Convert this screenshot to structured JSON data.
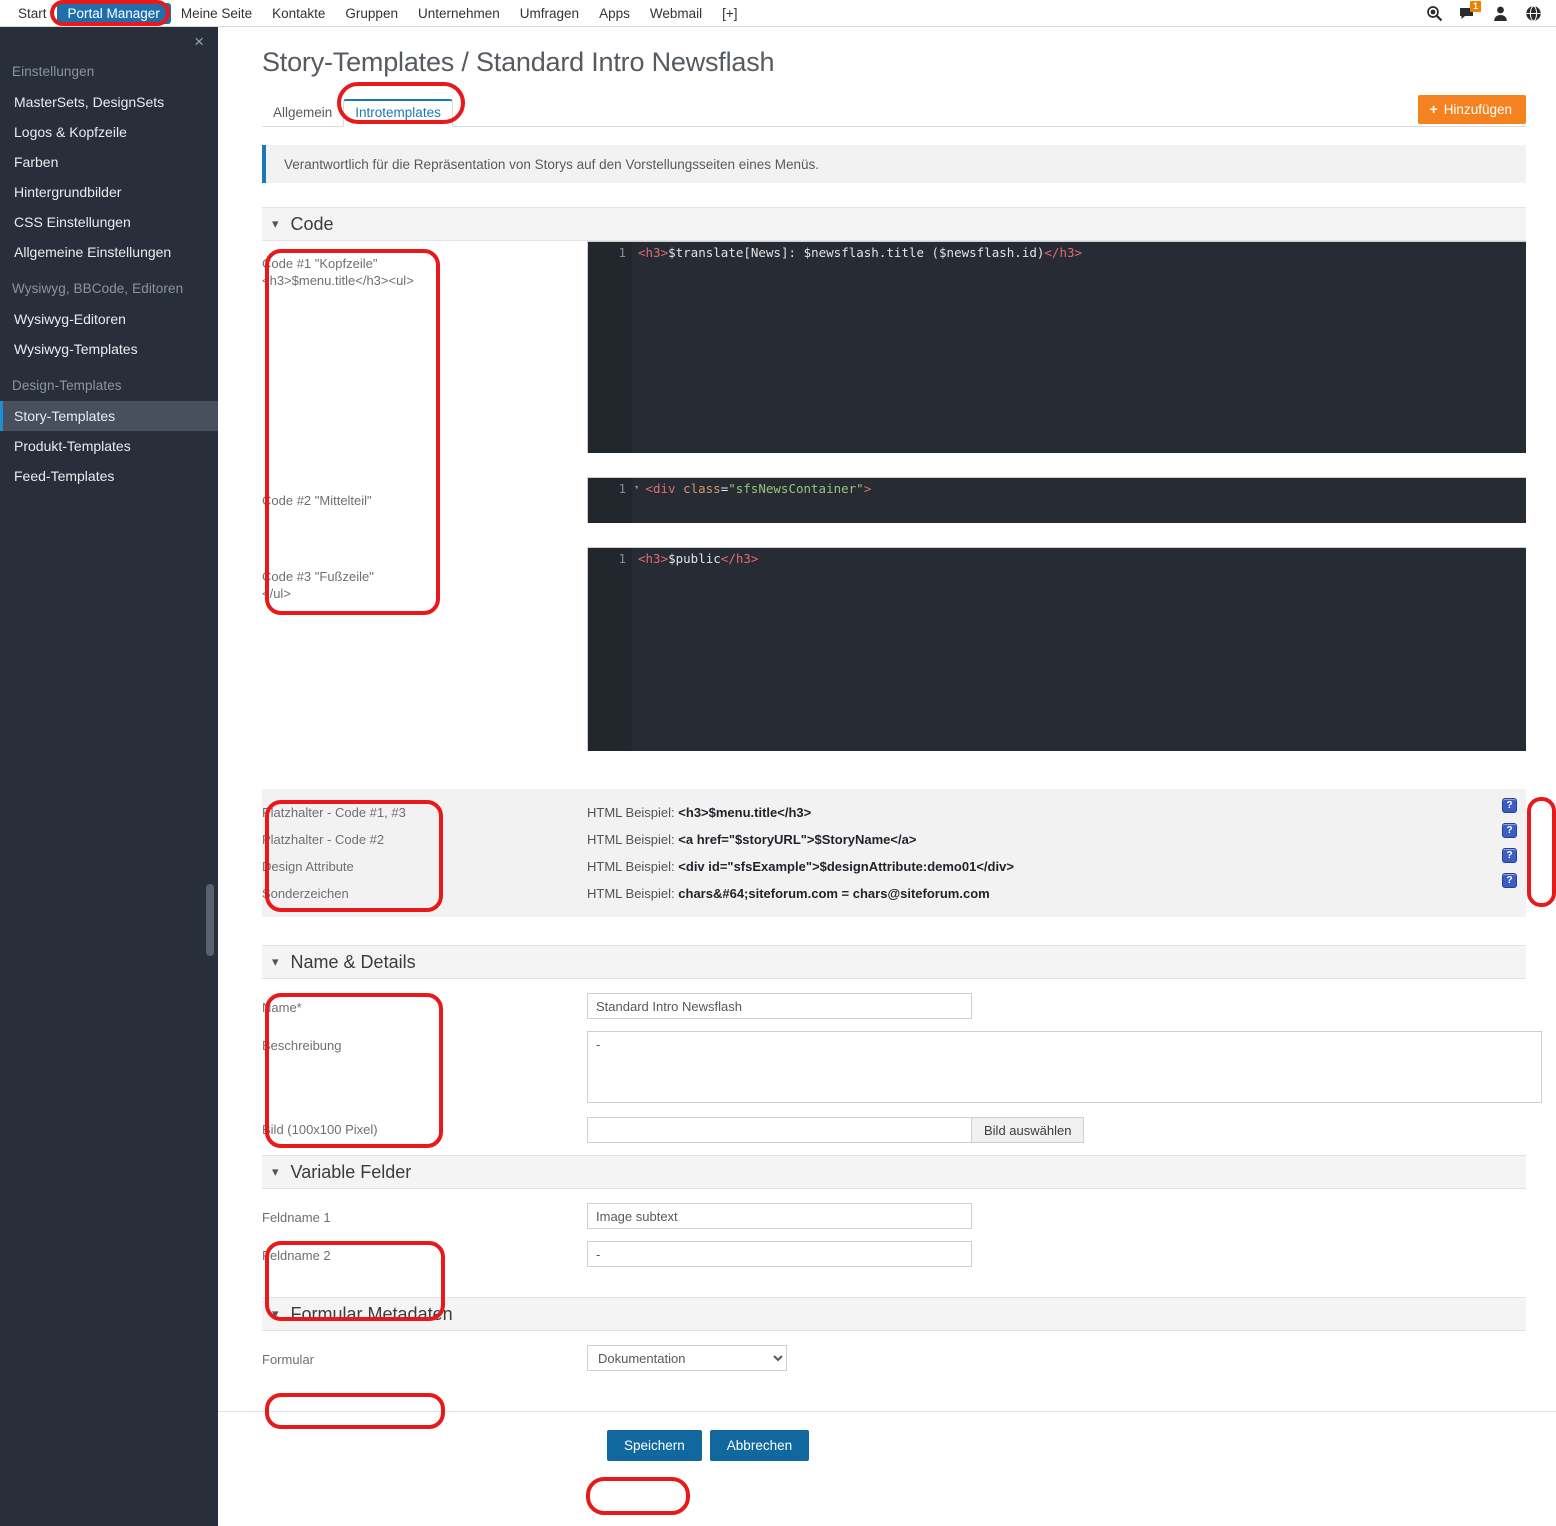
{
  "topnav": {
    "items": [
      {
        "label": "Start",
        "active": false
      },
      {
        "label": "Portal Manager",
        "active": true
      },
      {
        "label": "Meine Seite",
        "active": false
      },
      {
        "label": "Kontakte",
        "active": false
      },
      {
        "label": "Gruppen",
        "active": false
      },
      {
        "label": "Unternehmen",
        "active": false
      },
      {
        "label": "Umfragen",
        "active": false
      },
      {
        "label": "Apps",
        "active": false
      },
      {
        "label": "Webmail",
        "active": false
      },
      {
        "label": "[+]",
        "active": false
      }
    ],
    "icons": [
      "search-icon",
      "messages-icon",
      "user-icon",
      "globe-icon"
    ],
    "message_badge": "1",
    "badge_color": "#f08000",
    "active_color": "#1f6fad"
  },
  "sidebar": {
    "close_label": "×",
    "groups": [
      {
        "title": "Einstellungen",
        "items": [
          {
            "label": "MasterSets, DesignSets",
            "selected": false
          },
          {
            "label": "Logos & Kopfzeile",
            "selected": false
          },
          {
            "label": "Farben",
            "selected": false
          },
          {
            "label": "Hintergrundbilder",
            "selected": false
          },
          {
            "label": "CSS Einstellungen",
            "selected": false
          },
          {
            "label": "Allgemeine Einstellungen",
            "selected": false
          }
        ]
      },
      {
        "title": "Wysiwyg, BBCode, Editoren",
        "items": [
          {
            "label": "Wysiwyg-Editoren",
            "selected": false
          },
          {
            "label": "Wysiwyg-Templates",
            "selected": false
          }
        ]
      },
      {
        "title": "Design-Templates",
        "items": [
          {
            "label": "Story-Templates",
            "selected": true
          },
          {
            "label": "Produkt-Templates",
            "selected": false
          },
          {
            "label": "Feed-Templates",
            "selected": false
          }
        ]
      }
    ],
    "accent_color": "#1b8fd4",
    "background": "#282f3a"
  },
  "page": {
    "title": "Story-Templates / Standard Intro Newsflash",
    "tabs": [
      {
        "label": "Allgemein",
        "active": false
      },
      {
        "label": "Introtemplates",
        "active": true
      }
    ],
    "add_button": {
      "label": "Hinzufügen",
      "icon": "plus-icon",
      "color": "#f58220"
    },
    "info_text": "Verantwortlich für die Repräsentation von Storys auf den Vorstellungsseiten eines Menüs."
  },
  "sections": {
    "code": {
      "title": "Code",
      "labels": [
        {
          "line1": "Code #1 \"Kopfzeile\"",
          "line2": "<h3>$menu.title</h3><ul>"
        },
        {
          "line1": "Code #2 \"Mittelteil\"",
          "line2": ""
        },
        {
          "line1": "Code #3 \"Fußzeile\"",
          "line2": "</ul>"
        }
      ],
      "editors": [
        {
          "line_number": "1",
          "folded": false,
          "tokens": [
            {
              "t": "<h3>",
              "k": "tag"
            },
            {
              "t": "$translate[News]: $newsflash.title ($newsflash.id)",
              "k": "plain"
            },
            {
              "t": "</h3>",
              "k": "tag"
            }
          ]
        },
        {
          "line_number": "1",
          "folded": true,
          "tokens": [
            {
              "t": "<div ",
              "k": "tag"
            },
            {
              "t": "class",
              "k": "attr"
            },
            {
              "t": "=",
              "k": "op"
            },
            {
              "t": "\"sfsNewsContainer\"",
              "k": "str"
            },
            {
              "t": ">",
              "k": "tag"
            }
          ]
        },
        {
          "line_number": "1",
          "folded": false,
          "tokens": [
            {
              "t": "<h3>",
              "k": "tag"
            },
            {
              "t": "$public",
              "k": "plain"
            },
            {
              "t": "</h3>",
              "k": "tag"
            }
          ]
        }
      ]
    },
    "examples": {
      "labels": [
        "Platzhalter - Code #1, #3",
        "Platzhalter - Code #2",
        "Design Attribute",
        "Sonderzeichen"
      ],
      "rows": [
        {
          "prefix": "HTML Beispiel: ",
          "code": "<h3>$menu.title</h3>"
        },
        {
          "prefix": "HTML Beispiel: ",
          "code": "<a href=\"$storyURL\">$StoryName</a>"
        },
        {
          "prefix": "HTML Beispiel: ",
          "code": "<div id=\"sfsExample\">$designAttribute:demo01</div>"
        },
        {
          "prefix": "HTML Beispiel: ",
          "code": "chars&#64;siteforum.com = chars@siteforum.com"
        }
      ],
      "help_icon_label": "?",
      "help_icon_count": 4
    },
    "name_details": {
      "title": "Name & Details",
      "labels": [
        "Name*",
        "Beschreibung",
        "Bild (100x100 Pixel)"
      ],
      "name_value": "Standard Intro Newsflash",
      "description_value": "-",
      "image_value": "",
      "image_button": "Bild auswählen"
    },
    "variable_fields": {
      "title": "Variable Felder",
      "labels": [
        "Feldname 1",
        "Feldname 2"
      ],
      "values": [
        "Image subtext",
        "-"
      ]
    },
    "form_metadata": {
      "title": "Formular Metadaten",
      "label": "Formular",
      "selected": "Dokumentation",
      "options": [
        "Dokumentation"
      ]
    }
  },
  "footer": {
    "save_label": "Speichern",
    "cancel_label": "Abbrechen",
    "button_color": "#11689f"
  }
}
